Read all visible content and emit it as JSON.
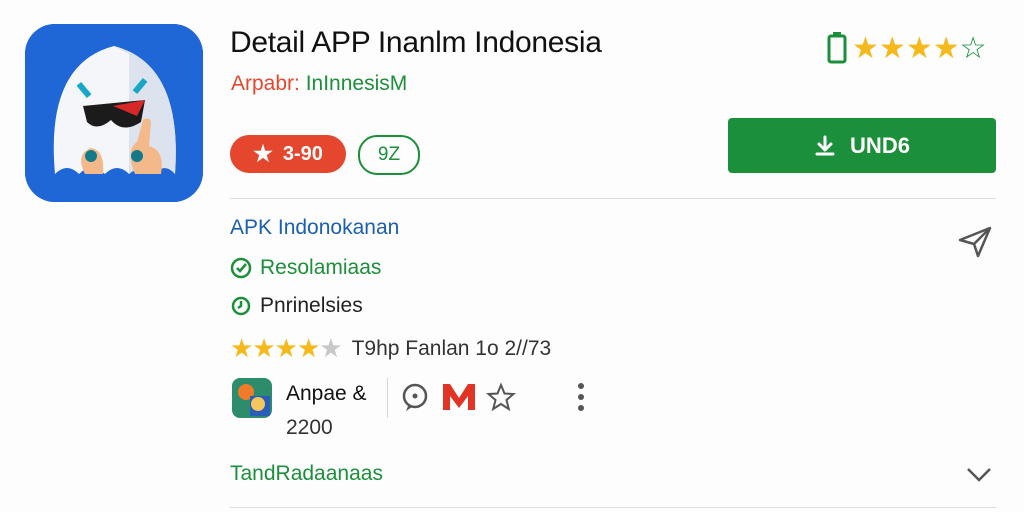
{
  "header": {
    "title": "Detail APP Inanlm Indonesia",
    "developer_prefix": "Arpabr: ",
    "developer_name": "InInnesisM"
  },
  "top_rating": {
    "stars_filled": 4,
    "stars_total": 5,
    "icon": "battery-icon"
  },
  "badges": {
    "rating": "3-90",
    "count": "9Z"
  },
  "install": {
    "label": "UND6",
    "icon": "download-icon"
  },
  "details": {
    "category": "APK Indonokanan",
    "feature_1": "Resolamiaas",
    "feature_2": "Pnrinelsies",
    "rating_text": "T9hp Fanlan 1o 2//73",
    "rating_stars": 4
  },
  "author": {
    "name": "Anpae &",
    "number": "2200"
  },
  "actions": {
    "icons": [
      "chat-icon",
      "m-logo-icon",
      "star-outline-icon",
      "more-vertical-icon"
    ]
  },
  "section": {
    "label": "TandRadaanaas",
    "icon": "chevron-down-icon"
  },
  "colors": {
    "green": "#1c8f3a",
    "red": "#e4472e",
    "blue": "#1f66d6",
    "star": "#f6b91b"
  }
}
